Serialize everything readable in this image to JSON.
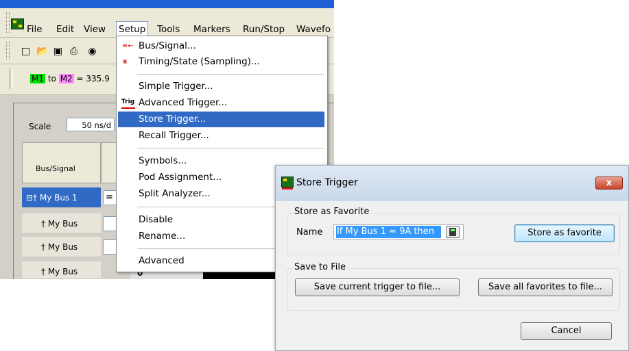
{
  "app": {
    "menubar": [
      "File",
      "Edit",
      "View",
      "Setup",
      "Tools",
      "Markers",
      "Run/Stop",
      "Wavefo"
    ],
    "markers": {
      "m1": "M1",
      "to": "to",
      "m2": "M2",
      "value": "= 335.9"
    },
    "scale_label": "Scale",
    "scale_value": "50 ns/d",
    "column_header": "Bus/Signal",
    "rows": [
      "My Bus 1",
      "My Bus",
      "My Bus",
      "My Bus"
    ],
    "cells": [
      "=",
      "",
      "",
      "0"
    ]
  },
  "setup_menu": {
    "items": [
      {
        "label": "Bus/Signal...",
        "icon": "bus-signal-icon"
      },
      {
        "label": "Timing/State (Sampling)...",
        "icon": "timing-state-icon"
      },
      {
        "label": "Simple Trigger..."
      },
      {
        "label": "Advanced Trigger...",
        "icon": "trig-icon"
      },
      {
        "label": "Store Trigger..."
      },
      {
        "label": "Recall Trigger..."
      },
      {
        "label": "Symbols..."
      },
      {
        "label": "Pod Assignment..."
      },
      {
        "label": "Split Analyzer..."
      },
      {
        "label": "Disable"
      },
      {
        "label": "Rename..."
      },
      {
        "label": "Advanced"
      }
    ],
    "highlighted_index": 4
  },
  "dialog": {
    "title": "Store Trigger",
    "close_label": "x",
    "favorite_group": "Store as Favorite",
    "name_label": "Name",
    "name_value": "If My Bus 1 = 9A then",
    "store_favorite_button": "Store as favorite",
    "file_group": "Save to File",
    "save_current_button": "Save current trigger to file...",
    "save_all_button": "Save all favorites to file...",
    "cancel_button": "Cancel"
  },
  "colors": {
    "highlight": "#316ac5",
    "m1": "#00e000",
    "m2": "#ff88ff",
    "dialog_bg": "#f0f0f0"
  }
}
